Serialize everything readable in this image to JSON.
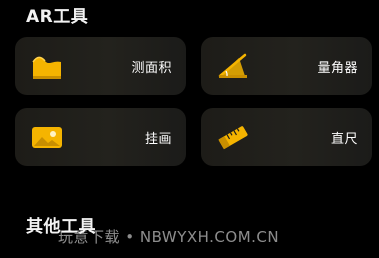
{
  "sections": {
    "ar_title": "AR工具",
    "other_title": "其他工具"
  },
  "tools": {
    "measure": {
      "label": "测面积",
      "icon": "area-measure-icon"
    },
    "angle": {
      "label": "量角器",
      "icon": "protractor-icon"
    },
    "hang": {
      "label": "挂画",
      "icon": "picture-hanging-icon"
    },
    "ruler": {
      "label": "直尺",
      "icon": "ruler-icon"
    }
  },
  "watermark": "玩意下载 • NBWYXH.COM.CN",
  "colors": {
    "accent": "#f5b400",
    "tile_bg": "#1f1e1a",
    "background": "#000000"
  }
}
